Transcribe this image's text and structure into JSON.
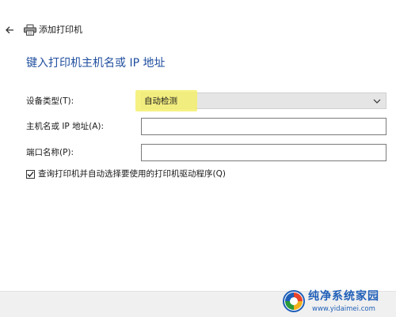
{
  "header": {
    "title": "添加打印机",
    "back_icon": "arrow-left-icon",
    "printer_icon": "printer-icon"
  },
  "main": {
    "heading": "键入打印机主机名或 IP 地址",
    "device_type": {
      "label": "设备类型(T):",
      "value": "自动检测"
    },
    "host": {
      "label": "主机名或 IP 地址(A):",
      "value": ""
    },
    "port": {
      "label": "端口名称(P):",
      "value": ""
    },
    "query_checkbox": {
      "label": "查询打印机并自动选择要使用的打印机驱动程序(Q)",
      "checked": true
    }
  },
  "watermark": {
    "title": "纯净系统家园",
    "url": "www.yidaimei.com"
  },
  "colors": {
    "heading_blue": "#1f4e9e",
    "highlight_yellow": "#f5ef6d",
    "watermark_blue": "#1f5fb8"
  }
}
